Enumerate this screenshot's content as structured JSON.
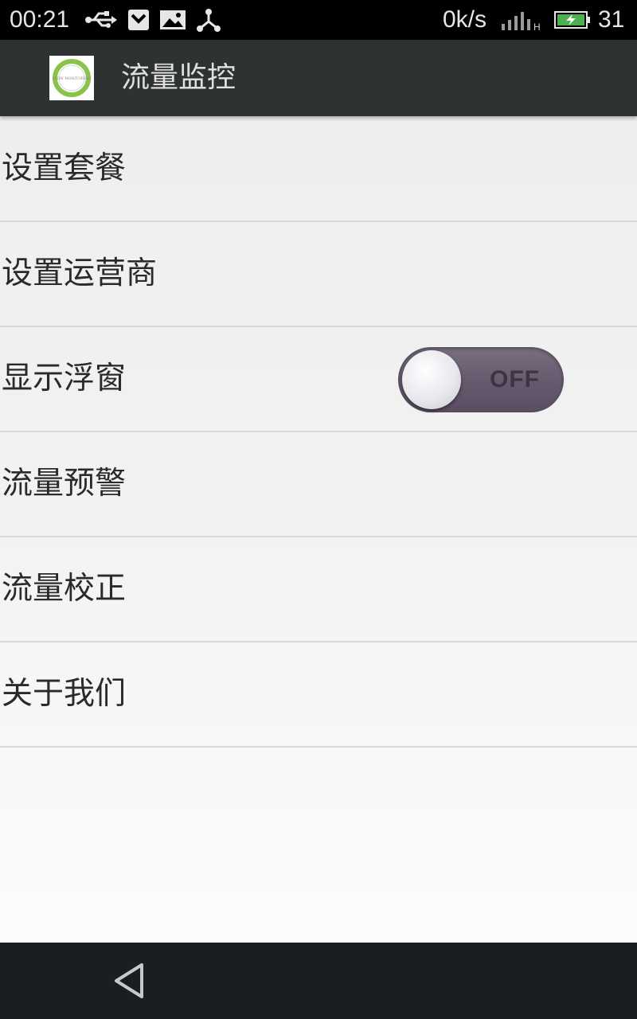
{
  "status_bar": {
    "time": "00:21",
    "network_speed": "0k/s",
    "battery_level": "31",
    "signal_type": "H",
    "icons": [
      "usb-icon",
      "notification-icon",
      "image-icon",
      "share-icon",
      "signal-icon",
      "battery-charging-icon"
    ],
    "battery_color": "#4caf50"
  },
  "action_bar": {
    "title": "流量监控",
    "logo_text": "FLOW MONITORING",
    "logo_ring_color": "#8bc34a"
  },
  "list": {
    "items": [
      {
        "label": "设置套餐"
      },
      {
        "label": "设置运营商"
      },
      {
        "label": "显示浮窗",
        "toggle_state": "OFF"
      },
      {
        "label": "流量预警"
      },
      {
        "label": "流量校正"
      },
      {
        "label": "关于我们"
      }
    ]
  },
  "nav_bar": {
    "icons": [
      "back-icon"
    ]
  }
}
